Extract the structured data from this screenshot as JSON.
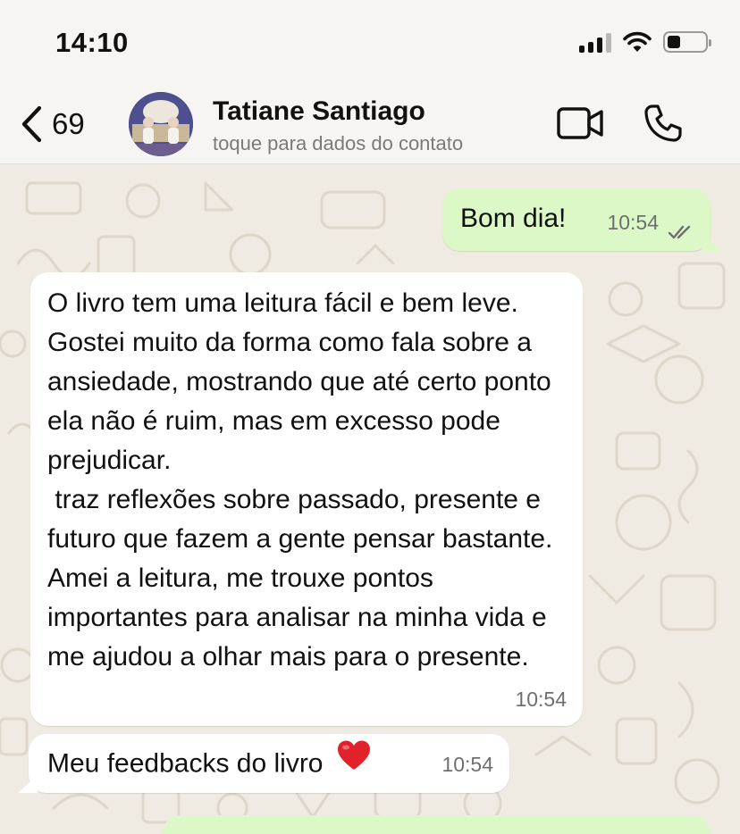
{
  "status_bar": {
    "time": "14:10"
  },
  "header": {
    "back_count": "69",
    "contact_name": "Tatiane Santiago",
    "contact_subtitle": "toque para dados do contato"
  },
  "messages": [
    {
      "direction": "outgoing",
      "text": "Bom dia!",
      "time": "10:54",
      "status": "read"
    },
    {
      "direction": "incoming",
      "text": "O livro tem uma leitura fácil e bem leve. Gostei muito da forma como fala sobre a ansiedade, mostrando que até certo ponto ela não é ruim, mas em excesso pode prejudicar.\n traz reflexões sobre passado, presente e futuro que fazem a gente pensar bastante. Amei a leitura, me trouxe pontos importantes para analisar na minha vida e me ajudou a olhar mais para o presente.",
      "time": "10:54"
    },
    {
      "direction": "incoming",
      "text": "Meu feedbacks do livro",
      "emoji": "red-heart-icon",
      "time": "10:54"
    }
  ],
  "colors": {
    "outgoing_bubble": "#dcf8c6",
    "incoming_bubble": "#ffffff",
    "chat_background": "#efeae2",
    "icon": "#111111"
  },
  "icons": [
    "back-chevron-icon",
    "video-call-icon",
    "phone-icon",
    "wifi-icon",
    "signal-icon",
    "battery-icon",
    "double-check-icon"
  ]
}
